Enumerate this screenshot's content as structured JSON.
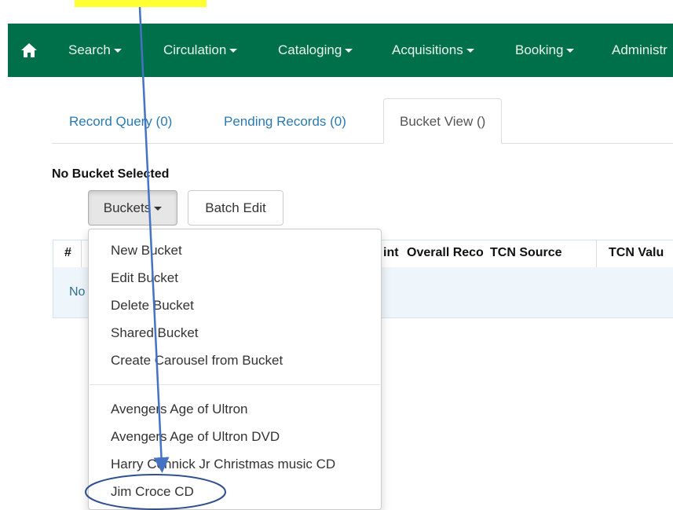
{
  "navbar": {
    "background": "#00704a",
    "home_icon": "home-icon",
    "items": [
      {
        "label": "Search",
        "has_caret": true
      },
      {
        "label": "Circulation",
        "has_caret": true
      },
      {
        "label": "Cataloging",
        "has_caret": true
      },
      {
        "label": "Acquisitions",
        "has_caret": true
      },
      {
        "label": "Booking",
        "has_caret": true
      },
      {
        "label": "Administr",
        "has_caret": false
      }
    ]
  },
  "tabs": [
    {
      "label": "Record Query (0)",
      "active": false
    },
    {
      "label": "Pending Records (0)",
      "active": false
    },
    {
      "label": "Bucket View ()",
      "active": true
    }
  ],
  "bucket": {
    "title": "No Bucket Selected",
    "buckets_button": "Buckets",
    "batch_edit_button": "Batch Edit"
  },
  "grid": {
    "hash_header": "#",
    "columns": [
      "int",
      "Overall Reco",
      "TCN Source",
      "TCN Valu"
    ],
    "empty_text": "No"
  },
  "dropdown": {
    "actions": [
      "New Bucket",
      "Edit Bucket",
      "Delete Bucket",
      "Shared Bucket",
      "Create Carousel from Bucket"
    ],
    "buckets": [
      "Avengers Age of Ultron",
      "Avengers Age of Ultron DVD",
      "Harry Connick Jr Christmas music CD",
      "Jim Croce CD"
    ],
    "circled_item": "Jim Croce CD"
  },
  "annotation": {
    "highlight_color": "#ffff33",
    "arrow_color": "#4472c4",
    "circle_color": "#2f4f8f"
  }
}
